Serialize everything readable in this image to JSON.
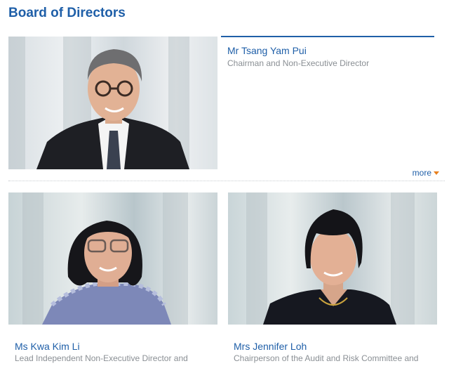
{
  "page": {
    "title": "Board of Directors"
  },
  "directors": [
    {
      "name": "Mr Tsang Yam Pui",
      "role": "Chairman and Non-Executive Director",
      "more_label": "more"
    },
    {
      "name": "Ms Kwa Kim Li",
      "role": "Lead Independent Non-Executive Director and"
    },
    {
      "name": "Mrs Jennifer Loh",
      "role": "Chairperson of the Audit and Risk Committee and"
    }
  ],
  "colors": {
    "accent": "#1f5fa8",
    "caret": "#e8801e",
    "role_text": "#8a8f94"
  },
  "icons": {
    "more": "caret-down-icon"
  }
}
